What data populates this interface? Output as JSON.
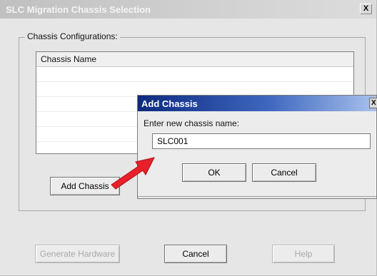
{
  "window": {
    "title": "SLC Migration Chassis Selection",
    "close_glyph": "X"
  },
  "chassis_group": {
    "label": "Chassis Configurations:",
    "columns": [
      "Chassis Name"
    ],
    "rows": []
  },
  "main_buttons": {
    "add_chassis": "Add Chassis",
    "generate_hardware": "Generate Hardware",
    "cancel": "Cancel",
    "help": "Help"
  },
  "add_chassis_dialog": {
    "title": "Add Chassis",
    "close_glyph": "X",
    "prompt": "Enter new chassis name:",
    "input_value": "SLC001",
    "ok": "OK",
    "cancel": "Cancel"
  },
  "annotation": {
    "arrow_color": "#e8202a",
    "arrow_icon": "pointer-arrow"
  }
}
